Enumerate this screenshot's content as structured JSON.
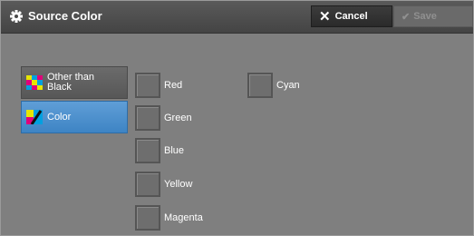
{
  "header": {
    "title": "Source Color",
    "title_icon": "gear-icon",
    "cancel_label": "Cancel",
    "save_label": "Save"
  },
  "sidebar": {
    "items": [
      {
        "label_line1": "Other than",
        "label_line2": "Black",
        "icon": "multicolor-icon",
        "selected": false
      },
      {
        "label": "Color",
        "icon": "color-palette-icon",
        "selected": true
      }
    ]
  },
  "options": {
    "red": "Red",
    "green": "Green",
    "blue": "Blue",
    "yellow": "Yellow",
    "magenta": "Magenta",
    "cyan": "Cyan"
  },
  "colors": {
    "background": "#7f7f7f",
    "header": "#4a4a4a",
    "selected": "#4a8fd0"
  }
}
